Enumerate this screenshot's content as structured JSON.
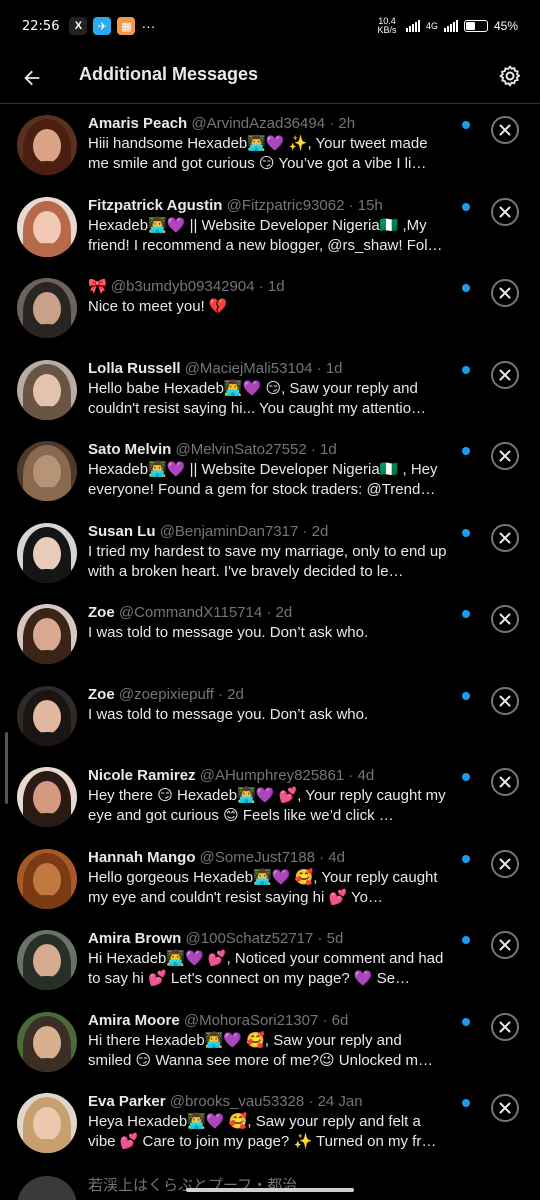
{
  "status": {
    "time": "22:56",
    "apps": [
      "x-icon",
      "telegram-icon",
      "app-icon",
      "more-dots"
    ],
    "net_speed": "10.4 KB/s",
    "network": "4G",
    "battery": "45%",
    "battery_fill": 0.45
  },
  "header": {
    "title": "Additional Messages"
  },
  "messages": [
    {
      "name": "Amaris Peach",
      "handle": "@ArvindAzad36494 · 2h",
      "text": "Hiii handsome Hexadeb👨‍💻💜 ✨, Your tweet made me smile and got curious 😏 You’ve got a vibe I li…",
      "hair": "#4a1f10",
      "face": "#d9a386",
      "bg": "#5a3020"
    },
    {
      "name": "Fitzpatrick Agustin",
      "handle": "@Fitzpatric93062 · 15h",
      "text": "Hexadeb👨‍💻💜 || Website Developer Nigeria🇳🇬 ,My friend! I recommend a new blogger, @rs_shaw! Fol…",
      "hair": "#b76a4a",
      "face": "#f0c8b4",
      "bg": "#e8d8d0"
    },
    {
      "name": "🎀",
      "handle": "@b3umdyb09342904 · 1d",
      "text": "Nice to meet you! 💔",
      "hair": "#2a2522",
      "face": "#c9a08a",
      "bg": "#6b625c"
    },
    {
      "name": "Lolla Russell",
      "handle": "@MaciejMali53104 · 1d",
      "text": "Hello babe Hexadeb👨‍💻💜 😏, Saw your reply and couldn't resist saying hi... You caught my attentio…",
      "hair": "#6a5446",
      "face": "#e3c2ae",
      "bg": "#b8aca4"
    },
    {
      "name": "Sato Melvin",
      "handle": "@MelvinSato27552 · 1d",
      "text": "Hexadeb👨‍💻💜 || Website Developer Nigeria🇳🇬 , Hey everyone! Found a gem for stock traders: @Trend…",
      "hair": "#8a6a4e",
      "face": "#b89476",
      "bg": "#4e3a2c"
    },
    {
      "name": "Susan Lu",
      "handle": "@BenjaminDan7317 · 2d",
      "text": "I tried my hardest to save my marriage, only to end up with a broken heart. I've bravely decided to le…",
      "hair": "#151515",
      "face": "#e8cbb9",
      "bg": "#d9d4d0"
    },
    {
      "name": "Zoe",
      "handle": "@CommandX115714 · 2d",
      "text": "I was told to message you. Don’t ask who.",
      "hair": "#3a2418",
      "face": "#d8a890",
      "bg": "#d8c7c0"
    },
    {
      "name": "Zoe",
      "handle": "@zoepixiepuff · 2d",
      "text": "I was told to message you. Don’t ask who.",
      "hair": "#1a1412",
      "face": "#e0b8a0",
      "bg": "#2e2a28"
    },
    {
      "name": "Nicole Ramirez",
      "handle": "@AHumphrey825861 · 4d",
      "text": "Hey there 😏 Hexadeb👨‍💻💜 💕, Your reply caught my eye and got curious 😊 Feels like we’d click …",
      "hair": "#2a1a14",
      "face": "#d49a80",
      "bg": "#e8d8d0"
    },
    {
      "name": "Hannah Mango",
      "handle": "@SomeJust7188 · 4d",
      "text": "Hello gorgeous Hexadeb👨‍💻💜 🥰, Your reply caught my eye and couldn't resist saying hi 💕 Yo…",
      "hair": "#7a3a14",
      "face": "#c07a40",
      "bg": "#a85a24"
    },
    {
      "name": "Amira Brown",
      "handle": "@100Schatz52717 · 5d",
      "text": "Hi Hexadeb👨‍💻💜 💕, Noticed your comment and had to say hi 💕 Let's connect on my page? 💜 Se…",
      "hair": "#2a2e28",
      "face": "#d4ab8e",
      "bg": "#6a7466"
    },
    {
      "name": "Amira Moore",
      "handle": "@MohoraSori21307 · 6d",
      "text": "Hi there Hexadeb👨‍💻💜 🥰, Saw your reply and smiled 😏 Wanna see more of me?😉 Unlocked m…",
      "hair": "#3a2e26",
      "face": "#d8b090",
      "bg": "#4a6a3a"
    },
    {
      "name": "Eva Parker",
      "handle": "@brooks_vau53328 · 24 Jan",
      "text": "Heya Hexadeb👨‍💻💜 🥰, Saw your reply and felt a vibe 💕 Care to join my page? ✨ Turned on my fr…",
      "hair": "#c8a070",
      "face": "#ecc8b0",
      "bg": "#e0d6cc"
    }
  ],
  "partial_row": {
    "text": "若渓上はくらぶとプーフ・都治"
  }
}
